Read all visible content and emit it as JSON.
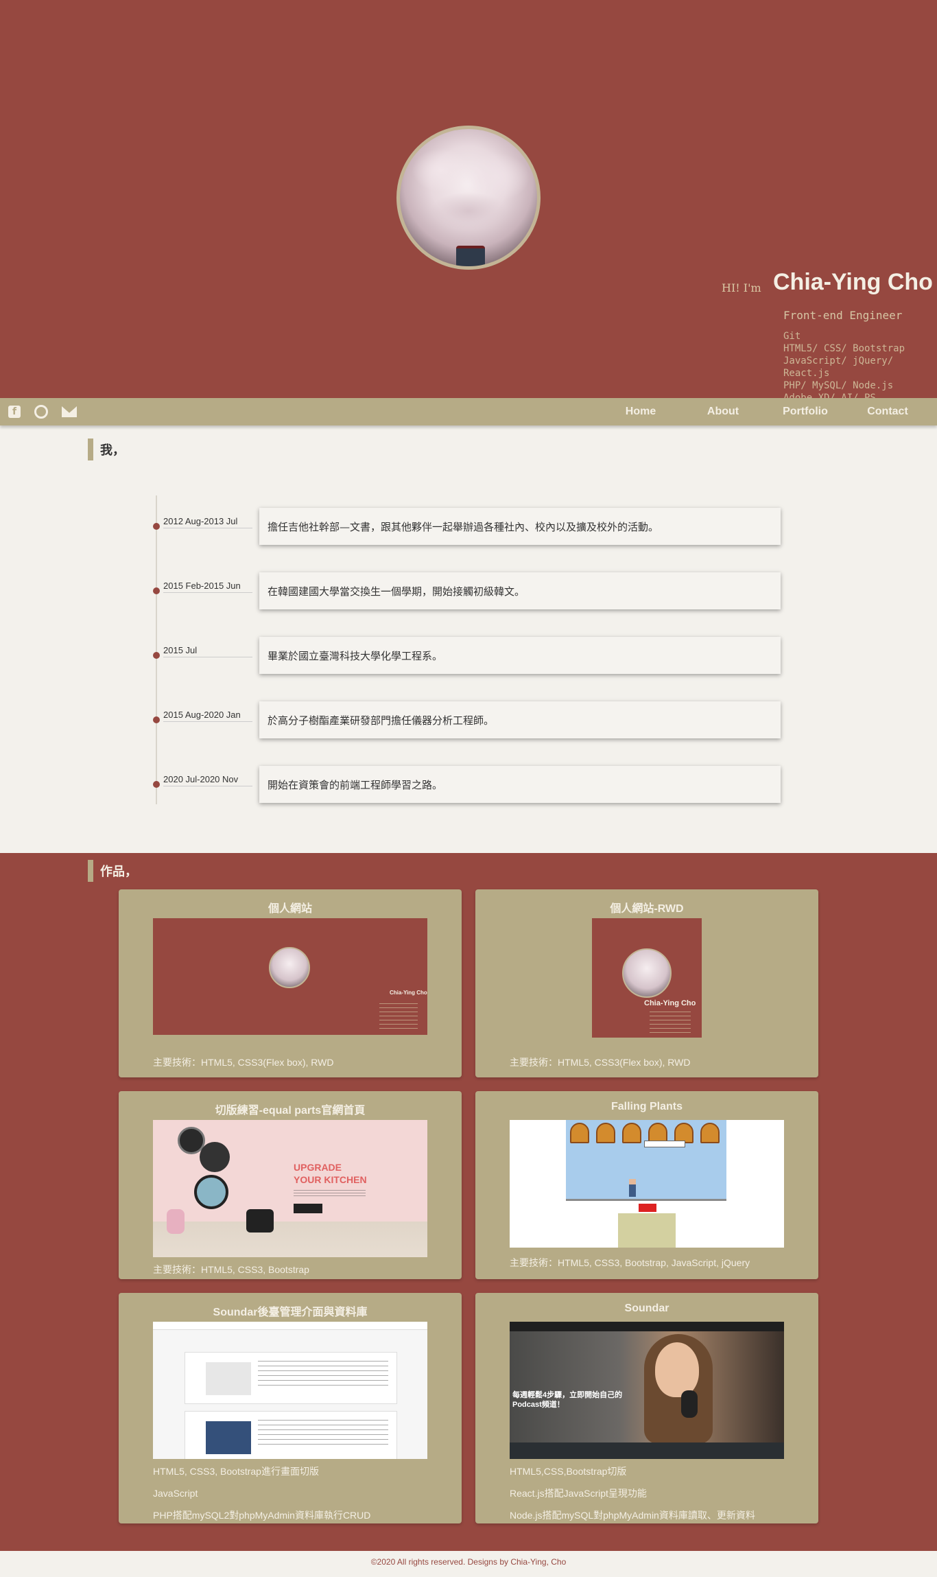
{
  "hero": {
    "greeting": "HI! I'm",
    "name": "Chia-Ying Cho",
    "role": "Front-end Engineer",
    "skills": [
      "Git",
      "HTML5/ CSS/ Bootstrap",
      "JavaScript/ jQuery/ React.js",
      "PHP/ MySQL/ Node.js",
      "Adobe XD/ AI/ PS"
    ]
  },
  "nav": {
    "social": [
      "facebook-icon",
      "github-icon",
      "mail-icon"
    ],
    "links": [
      "Home",
      "About",
      "Portfolio",
      "Contact"
    ]
  },
  "about": {
    "title": "我，",
    "timeline": [
      {
        "date": "2012 Aug-2013 Jul",
        "text": "擔任吉他社幹部—文書，跟其他夥伴一起舉辦過各種社內、校內以及擴及校外的活動。"
      },
      {
        "date": "2015 Feb-2015 Jun",
        "text": "在韓國建國大學當交換生一個學期，開始接觸初級韓文。"
      },
      {
        "date": "2015 Jul",
        "text": "畢業於國立臺灣科技大學化學工程系。"
      },
      {
        "date": "2015 Aug-2020 Jan",
        "text": "於高分子樹酯產業研發部門擔任儀器分析工程師。"
      },
      {
        "date": "2020 Jul-2020 Nov",
        "text": "開始在資策會的前端工程師學習之路。"
      }
    ]
  },
  "portfolio": {
    "title": "作品，",
    "cards": [
      {
        "title": "個人網站",
        "desc": [
          "主要技術：HTML5, CSS3(Flex box), RWD"
        ]
      },
      {
        "title": "個人網站-RWD",
        "desc": [
          "主要技術：HTML5, CSS3(Flex box), RWD"
        ]
      },
      {
        "title": "切版練習-equal parts官網首頁",
        "desc": [
          "主要技術：HTML5, CSS3, Bootstrap"
        ]
      },
      {
        "title": "Falling Plants",
        "desc": [
          "主要技術：HTML5, CSS3, Bootstrap, JavaScript, jQuery"
        ]
      },
      {
        "title": "Soundar後臺管理介面與資料庫",
        "desc": [
          "HTML5, CSS3, Bootstrap進行畫面切版",
          "JavaScript",
          "PHP搭配mySQL2對phpMyAdmin資料庫執行CRUD"
        ]
      },
      {
        "title": "Soundar",
        "desc": [
          "HTML5,CSS,Bootstrap切版",
          "React.js搭配JavaScript呈現功能",
          "Node.js搭配mySQL對phpMyAdmin資料庫讀取、更新資料"
        ]
      }
    ],
    "thumb_text": {
      "mini_name": "Chia-Ying Cho",
      "equal_title": "UPGRADE YOUR KITCHEN",
      "soundar_text": "每週輕鬆4步驟，立即開始自己的Podcast頻道！"
    }
  },
  "footer": {
    "text": "©2020 All rights reserved. Designs by Chia-Ying, Cho"
  },
  "colors": {
    "primary": "#964840",
    "accent": "#b6ab86",
    "background": "#f3f1ec",
    "text_light": "#f4efe4"
  }
}
